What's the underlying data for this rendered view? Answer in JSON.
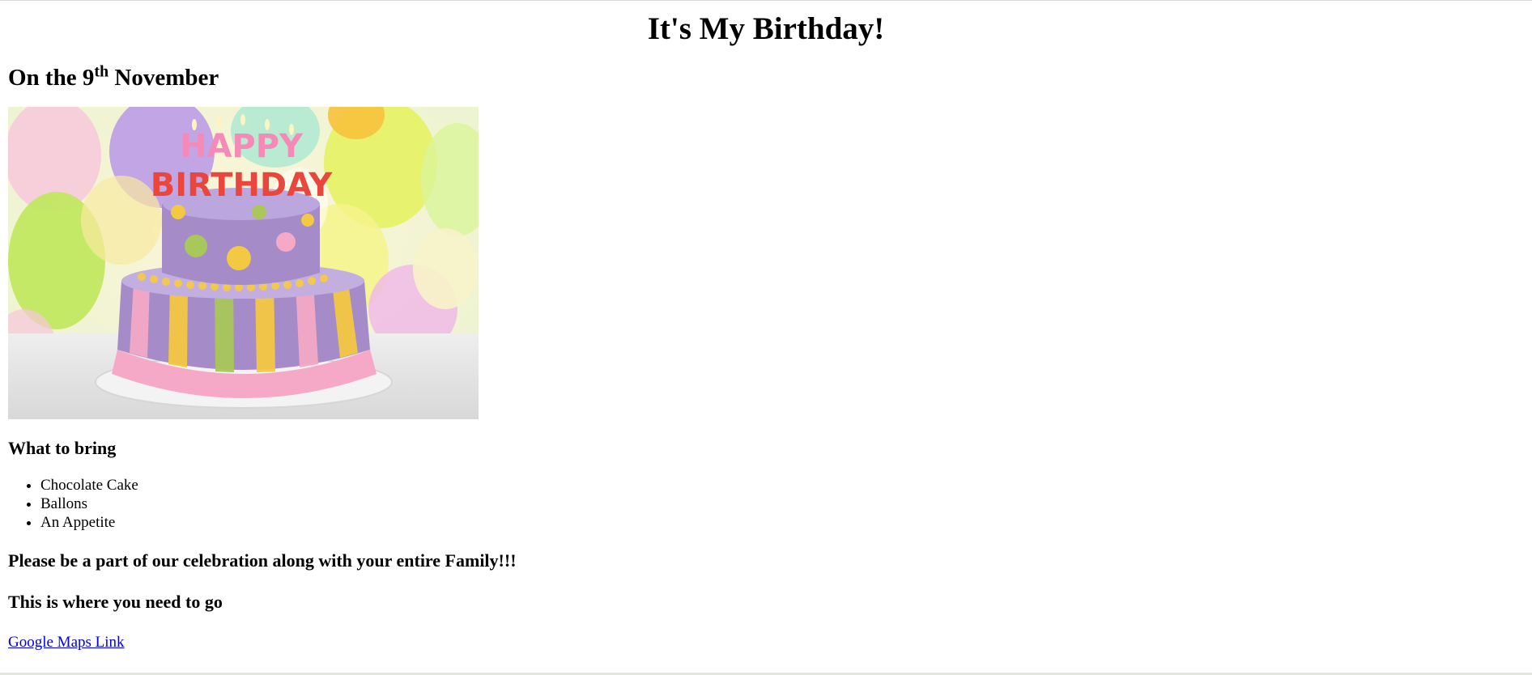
{
  "page": {
    "title": "It's My Birthday!",
    "date_prefix": "On the 9",
    "date_suffix": "th",
    "date_month": "November"
  },
  "image": {
    "cake_text_line1": "HAPPY",
    "cake_text_line2": "BIRTHDAY"
  },
  "bring": {
    "heading": "What to bring",
    "items": [
      "Chocolate Cake",
      "Ballons",
      "An Appetite"
    ]
  },
  "invite": {
    "message": "Please be a part of our celebration along with your entire Family!!!",
    "directions_heading": "This is where you need to go",
    "map_link_label": "Google Maps Link"
  },
  "colors": {
    "link": "#0000ee",
    "cake_purple": "#a58cc9",
    "cake_pink": "#f5a9c6",
    "cake_yellow": "#f3c842",
    "cake_green": "#a8c85a"
  }
}
